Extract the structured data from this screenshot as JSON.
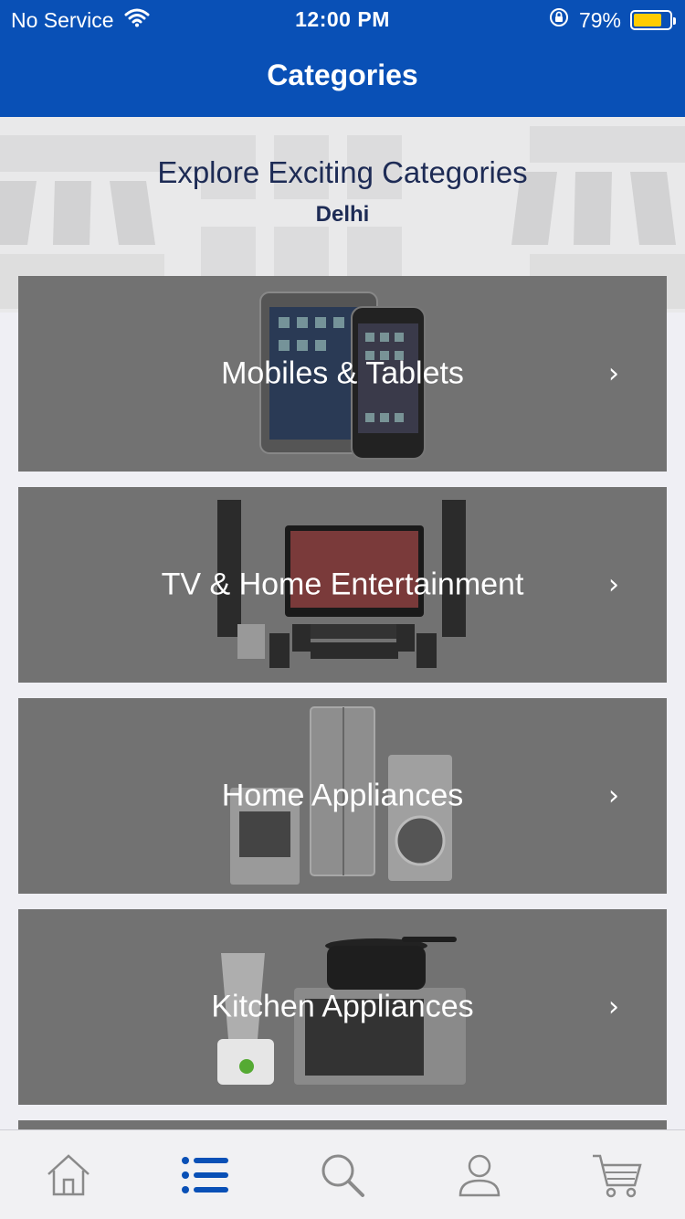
{
  "status_bar": {
    "carrier": "No Service",
    "time": "12:00 PM",
    "battery_percent": "79%",
    "battery_level": 0.79
  },
  "nav": {
    "title": "Categories"
  },
  "header": {
    "title": "Explore Exciting Categories",
    "location": "Delhi"
  },
  "categories": [
    {
      "label": "Mobiles & Tablets",
      "icon": "mobiles-tablets-image"
    },
    {
      "label": "TV & Home Entertainment",
      "icon": "tv-home-entertainment-image"
    },
    {
      "label": "Home Appliances",
      "icon": "home-appliances-image"
    },
    {
      "label": "Kitchen Appliances",
      "icon": "kitchen-appliances-image"
    }
  ],
  "tabbar": {
    "items": [
      "home-icon",
      "categories-list-icon",
      "search-icon",
      "profile-icon",
      "cart-icon"
    ],
    "active": "categories-list-icon"
  },
  "colors": {
    "brand": "#0950b6",
    "card_overlay": "#727272",
    "battery": "#ffcc00",
    "header_text": "#1d2b55"
  }
}
